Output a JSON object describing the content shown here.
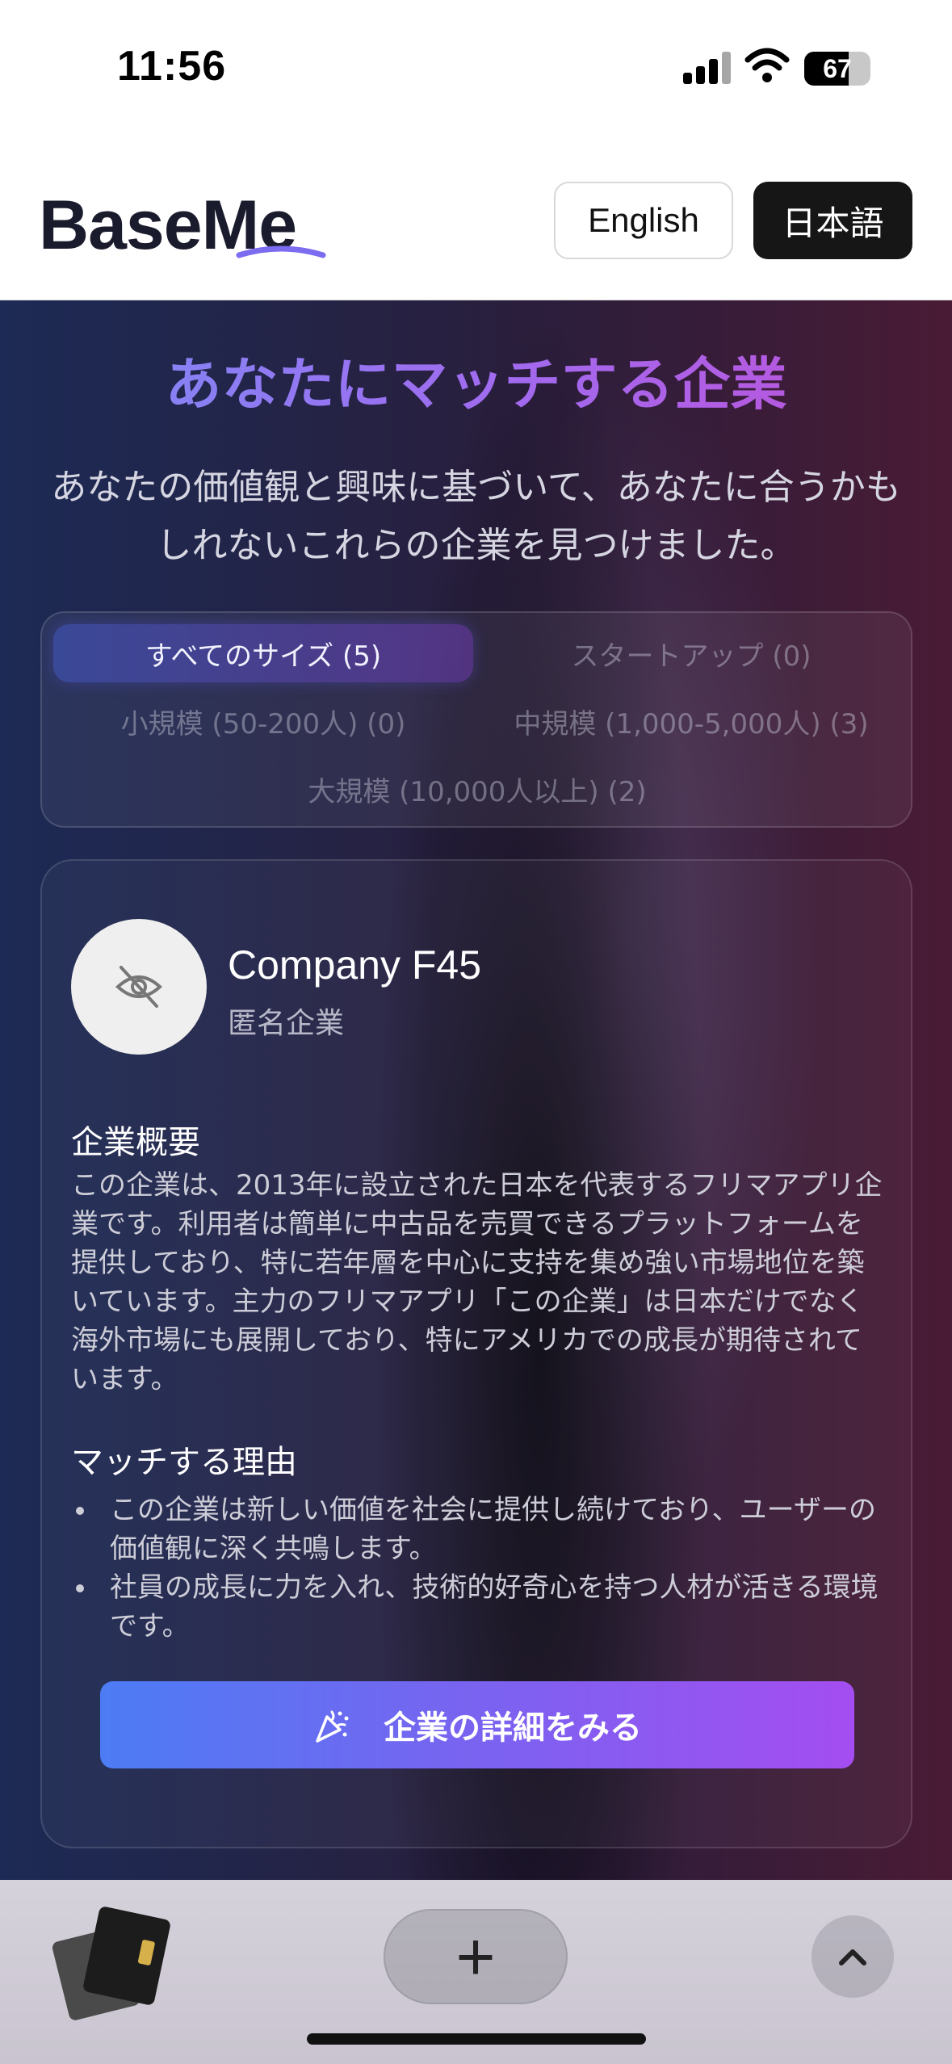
{
  "status_bar": {
    "time": "11:56",
    "battery_percent": "67",
    "battery_level": 0.67,
    "signal_icon": "cellular-signal-icon",
    "wifi_icon": "wifi-icon"
  },
  "header": {
    "logo": "BaseMe",
    "lang_english": "English",
    "lang_japanese": "日本語",
    "selected_language": "日本語"
  },
  "main": {
    "title": "あなたにマッチする企業",
    "subtitle": "あなたの価値観と興味に基づいて、あなたに合うかもしれないこれらの企業を見つけました。",
    "filters": [
      {
        "label": "すべてのサイズ (5)",
        "active": true
      },
      {
        "label": "スタートアップ (0)",
        "active": false
      },
      {
        "label": "小規模 (50-200人) (0)",
        "active": false
      },
      {
        "label": "中規模 (1,000-5,000人) (3)",
        "active": false
      },
      {
        "label": "大規模 (10,000人以上) (2)",
        "active": false
      }
    ]
  },
  "card": {
    "company_name": "Company F45",
    "company_type": "匿名企業",
    "avatar_icon": "eye-off-icon",
    "overview_title": "企業概要",
    "overview_body": "この企業は、2013年に設立された日本を代表するフリマアプリ企業です。利用者は簡単に中古品を売買できるプラットフォームを提供しており、特に若年層を中心に支持を集め強い市場地位を築いています。主力のフリマアプリ「この企業」は日本だけでなく海外市場にも展開しており、特にアメリカでの成長が期待されています。",
    "reasons_title": "マッチする理由",
    "reasons": [
      "この企業は新しい価値を社会に提供し続けており、ユーザーの価値観に深く共鳴します。",
      "社員の成長に力を入れ、技術的好奇心を持つ人材が活きる環境です。"
    ],
    "detail_button_label": "企業の詳細をみる",
    "detail_button_icon": "party-popper-icon"
  },
  "bottom_bar": {
    "tabs_icon": "tab-switcher-icon",
    "new_tab_label": "+",
    "scroll_up_icon": "chevron-up-icon"
  },
  "colors": {
    "title_gradient_start": "#7b8cf5",
    "title_gradient_end": "#c050d8",
    "button_gradient_start": "#4c7cf4",
    "button_gradient_end": "#a44df0",
    "lang_selected_bg": "#161616"
  }
}
